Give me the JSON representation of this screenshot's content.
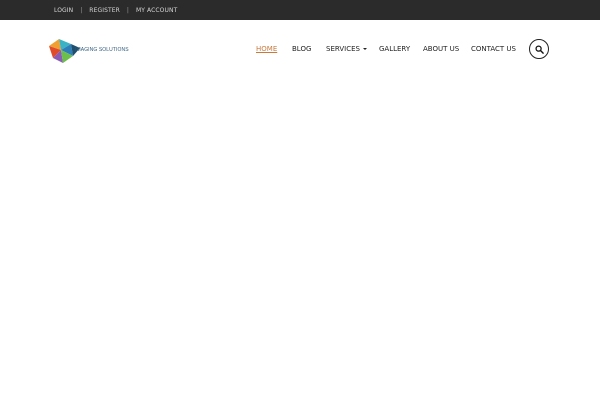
{
  "topbar": {
    "links": [
      "LOGIN",
      "REGISTER",
      "MY ACCOUNT"
    ],
    "separator": "|"
  },
  "logo": {
    "text": "IMAGING SOLUTIONS",
    "colors": [
      "#f0a030",
      "#e04b2a",
      "#2e7fb8",
      "#6cbf4a",
      "#8a5cb3",
      "#3bb3c4"
    ]
  },
  "nav": {
    "items": [
      {
        "label": "HOME",
        "active": true
      },
      {
        "label": "BLOG",
        "active": false
      },
      {
        "label": "SERVICES",
        "active": false,
        "has_dropdown": true
      },
      {
        "label": "GALLERY",
        "active": false
      },
      {
        "label": "ABOUT US",
        "active": false
      },
      {
        "label": "CONTACT US",
        "active": false
      }
    ]
  },
  "search": {
    "icon": "search-icon"
  },
  "colors": {
    "topbar_bg": "#2b2b2b",
    "active_nav": "#c87a3c",
    "text": "#222222"
  }
}
